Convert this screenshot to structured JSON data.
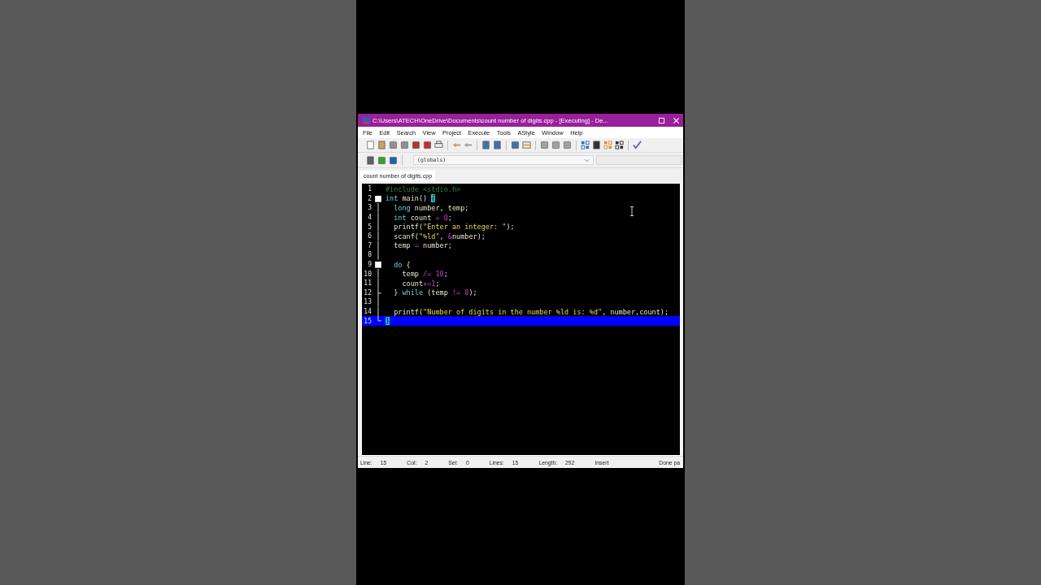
{
  "window": {
    "title": "C:\\Users\\ATECH\\OneDrive\\Documents\\count number of digits.cpp - [Executing] - De..."
  },
  "menu": [
    "File",
    "Edit",
    "Search",
    "View",
    "Project",
    "Execute",
    "Tools",
    "AStyle",
    "Window",
    "Help"
  ],
  "scope_dropdown": {
    "value": "(globals)"
  },
  "tabs": [
    {
      "label": "count number of digits.cpp",
      "selected": true
    }
  ],
  "editor": {
    "lines": [
      {
        "number": "1",
        "kind": "plain",
        "selected": false,
        "tokens": [
          {
            "kind": "pre",
            "text": "#include <stdio.h>"
          }
        ]
      },
      {
        "number": "2",
        "kind": "start",
        "selected": false,
        "tokens": [
          {
            "kind": "kw",
            "text": "int"
          },
          {
            "kind": "id",
            "text": " main() "
          },
          {
            "kind": "match",
            "text": "{"
          }
        ]
      },
      {
        "number": "3",
        "kind": "inside",
        "selected": false,
        "tokens": [
          {
            "kind": "kw",
            "text": "  long"
          },
          {
            "kind": "id",
            "text": " number, temp;"
          }
        ]
      },
      {
        "number": "4",
        "kind": "inside",
        "selected": false,
        "tokens": [
          {
            "kind": "kw",
            "text": "  int"
          },
          {
            "kind": "id",
            "text": " count "
          },
          {
            "kind": "op",
            "text": "="
          },
          {
            "kind": "num",
            "text": " 0"
          },
          {
            "kind": "id",
            "text": ";"
          }
        ]
      },
      {
        "number": "5",
        "kind": "inside",
        "selected": false,
        "tokens": [
          {
            "kind": "id",
            "text": "  printf("
          },
          {
            "kind": "str",
            "text": "\"Enter an integer: \""
          },
          {
            "kind": "id",
            "text": ");"
          }
        ]
      },
      {
        "number": "6",
        "kind": "inside",
        "selected": false,
        "tokens": [
          {
            "kind": "id",
            "text": "  scanf("
          },
          {
            "kind": "str",
            "text": "\"%ld\""
          },
          {
            "kind": "id",
            "text": ", "
          },
          {
            "kind": "op",
            "text": "&"
          },
          {
            "kind": "id",
            "text": "number);"
          }
        ]
      },
      {
        "number": "7",
        "kind": "inside",
        "selected": false,
        "tokens": [
          {
            "kind": "id",
            "text": "  temp "
          },
          {
            "kind": "op",
            "text": "="
          },
          {
            "kind": "id",
            "text": " number;"
          }
        ]
      },
      {
        "number": "8",
        "kind": "inside",
        "selected": false
      },
      {
        "number": "9",
        "kind": "start",
        "selected": false,
        "tokens": [
          {
            "kind": "kw",
            "text": "  do"
          },
          {
            "kind": "id",
            "text": " {"
          }
        ]
      },
      {
        "number": "10",
        "kind": "inside",
        "selected": false,
        "tokens": [
          {
            "kind": "id",
            "text": "    temp "
          },
          {
            "kind": "op",
            "text": "/="
          },
          {
            "kind": "num",
            "text": " 10"
          },
          {
            "kind": "id",
            "text": ";"
          }
        ]
      },
      {
        "number": "11",
        "kind": "inside",
        "selected": false,
        "tokens": [
          {
            "kind": "id",
            "text": "    count"
          },
          {
            "kind": "op",
            "text": "+="
          },
          {
            "kind": "num",
            "text": "1"
          },
          {
            "kind": "id",
            "text": ";"
          }
        ]
      },
      {
        "number": "12",
        "kind": "inner_end",
        "selected": false,
        "tokens": [
          {
            "kind": "id",
            "text": "  } "
          },
          {
            "kind": "kw",
            "text": "while"
          },
          {
            "kind": "id",
            "text": " (temp "
          },
          {
            "kind": "op",
            "text": "!="
          },
          {
            "kind": "num",
            "text": " 0"
          },
          {
            "kind": "id",
            "text": ");"
          }
        ]
      },
      {
        "number": "13",
        "kind": "inside",
        "selected": false
      },
      {
        "number": "14",
        "kind": "inside",
        "selected": false,
        "tokens": [
          {
            "kind": "id",
            "text": "  printf("
          },
          {
            "kind": "str",
            "text": "\"Number of digits in the number %ld is: %d\""
          },
          {
            "kind": "id",
            "text": ", number,count);"
          }
        ]
      },
      {
        "number": "15",
        "kind": "end",
        "selected": true,
        "tokens": [
          {
            "kind": "match",
            "text": "}"
          }
        ]
      }
    ]
  },
  "status_bar": [
    {
      "label": "Line:",
      "value": "15"
    },
    {
      "label": "Col:",
      "value": "2"
    },
    {
      "label": "Sel:",
      "value": "0"
    },
    {
      "label": "Lines:",
      "value": "15"
    },
    {
      "label": "Length:",
      "value": "292"
    },
    {
      "label": "Insert"
    },
    {
      "label": "Done pa"
    }
  ]
}
